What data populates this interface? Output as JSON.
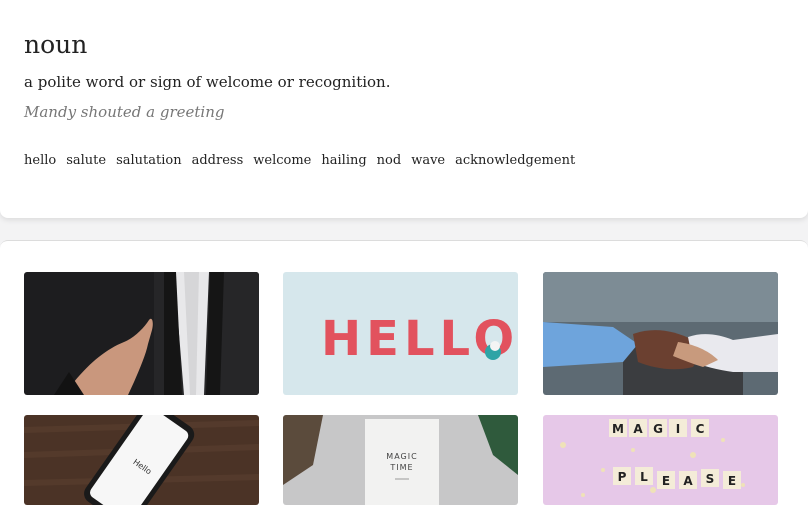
{
  "definition": {
    "part_of_speech": "noun",
    "meaning": "a polite word or sign of welcome or recognition.",
    "example": "Mandy shouted a greeting",
    "synonyms": [
      "hello",
      "salute",
      "salutation",
      "address",
      "welcome",
      "hailing",
      "nod",
      "wave",
      "acknowledgement"
    ]
  },
  "images": {
    "hello_sign": "HELLO",
    "phone_screen": "Hello",
    "card_line1": "MAGIC",
    "card_line2": "TIME",
    "tiles_word1": [
      "M",
      "A",
      "G",
      "I",
      "C"
    ],
    "tiles_word2": [
      "P",
      "L",
      "E",
      "A",
      "S",
      "E"
    ]
  },
  "colors": {
    "page_bg": "#f3f3f4",
    "card_bg": "#ffffff",
    "text": "#222222",
    "muted": "#777777"
  }
}
